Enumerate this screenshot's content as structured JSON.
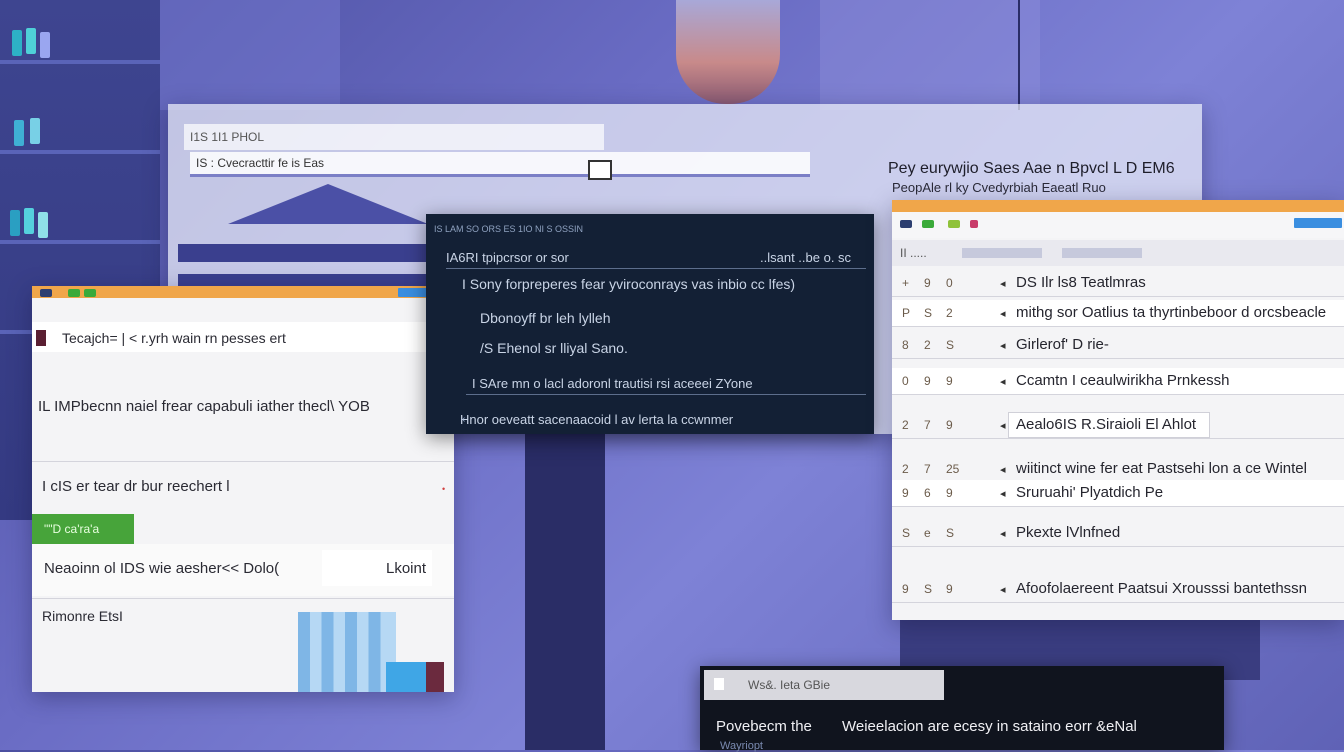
{
  "top_window": {
    "title": "I1S 1I1 PHOL",
    "address": "IS : Cvecracttir fe is Eas"
  },
  "left_window": {
    "search_text": "Tecajch= | <  r.yrh wain rn pesses ert",
    "body_text": "IL IMPbecnn naiel  frear capabuli iather thecl\\ YOB",
    "field_text": "I cIS er tear dr bur reechert l",
    "green_button": "\"\"D ca'ra'a",
    "row_text": "Neaoinn ol IDS  wie aesher<< Dolo(",
    "row_action": "Lkoint",
    "footer_text": "Rimonre EtsI"
  },
  "dark_panel": {
    "header": "IS LAM SO ORS ES 1IO NI S OSSIN",
    "line1": "IA6RI  tpipcrsor or sor",
    "line1_right": "..lsant ..be  o. sc",
    "line2": "I Sony forpreperes  fear yviroconrays  vas  inbio cc lfes)",
    "line3": "Dbonoyff  br leh  lylleh",
    "line4": "/S  Ehenol  sr lliyal  Sano.",
    "line5": "I SAre mn  o lacl adoronl  trautisi  rsi  aceeei ZYone",
    "line6": "Hnor oeveatt sacenaacoid   l av lerta la ccwnmer"
  },
  "right_window": {
    "header_text": "Pey eurywjio Saes Aae  n Bpvcl L D EM6",
    "header_sub": "PeopAle rl ky Cvedyrbiah Eaeatl Ruo",
    "tab_text": "II  .....",
    "items": [
      {
        "icons": [
          "+",
          "9",
          "0"
        ],
        "label": "DS Ilr ls8 Teatlmras"
      },
      {
        "icons": [
          "P",
          "S",
          "2"
        ],
        "label": "mithg sor Oatlius ta thyrtinbeboor d orcsbeacle"
      },
      {
        "icons": [
          "8",
          "2",
          "S"
        ],
        "label": "Girlerof' D rie-"
      },
      {
        "icons": [
          "0",
          "9",
          "9"
        ],
        "label": "Ccamtn  I ceaulwirikha Prnkessh"
      },
      {
        "icons": [
          "2",
          "7",
          "9"
        ],
        "label": "Aealo6IS R.Siraioli El Ahlot"
      },
      {
        "icons": [
          "2",
          "7",
          "25"
        ],
        "label": "wiitinct wine  fer eat Pastsehi lon a ce Wintel"
      },
      {
        "icons": [
          "9",
          "6",
          "9"
        ],
        "label": "Sruruahi' Plyatdich Pe"
      },
      {
        "icons": [
          "S",
          "e",
          "S"
        ],
        "label": "Pkexte lVlnfned"
      },
      {
        "icons": [
          "9",
          "S",
          "9"
        ],
        "label": "Afoofolaereent Paatsui   Xrousssi bantethssn"
      }
    ]
  },
  "bottom_panel": {
    "label": "Ws&. Ieta GBie",
    "line1": "Povebecm the",
    "line1_right": "Weieelacion  are ecesy  in sataino eorr &eNal",
    "line2": "Wayriopt"
  },
  "colors": {
    "titlebar": "#f0a64a",
    "accent_blue": "#3a8ee0",
    "green": "#47a43a",
    "dark_panel": "#132035"
  }
}
